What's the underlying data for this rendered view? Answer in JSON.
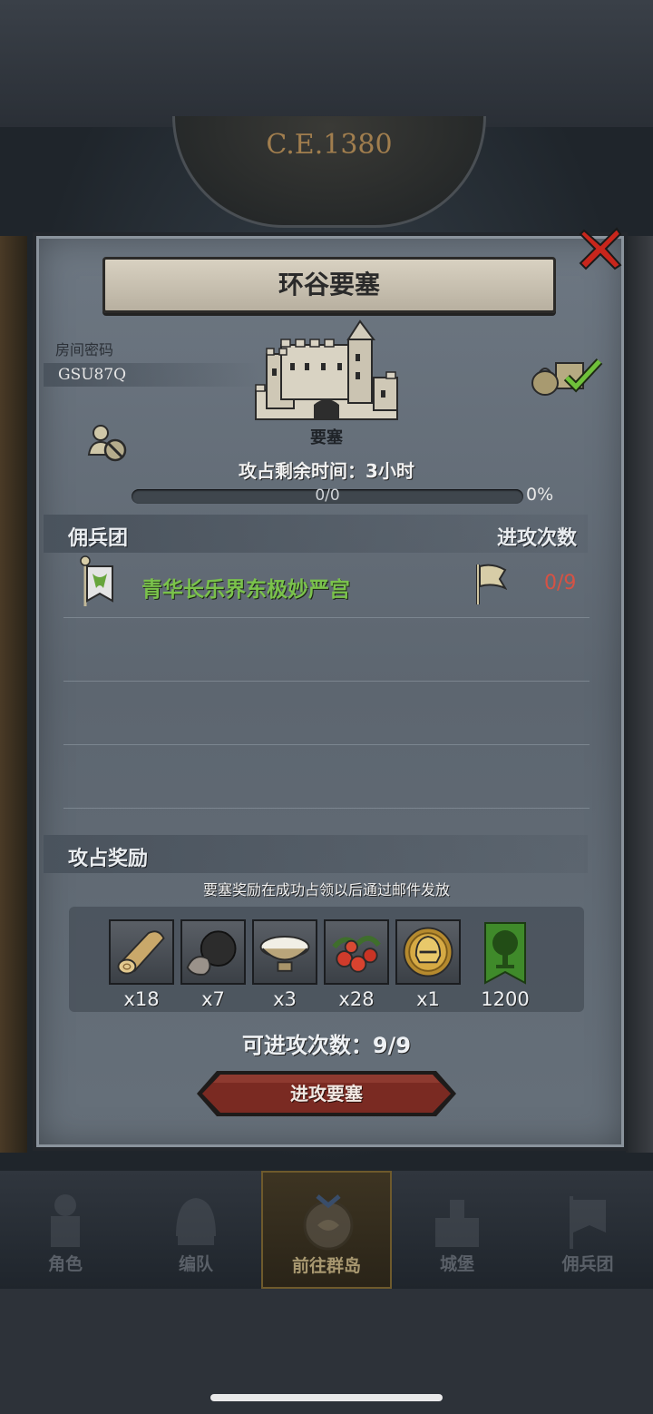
{
  "header": {
    "year": "C.E.1380"
  },
  "dialog": {
    "title": "环谷要塞",
    "room_label": "房间密码",
    "room_code": "GSU87Q",
    "fort_label": "要塞",
    "time_left": "攻占剩余时间：3小时",
    "progress": {
      "text": "0/0",
      "percent_label": "0%",
      "fraction": 0
    }
  },
  "mercenary": {
    "section_title": "佣兵团",
    "attack_header": "进攻次数",
    "rows": [
      {
        "name": "青华长乐界东极妙严宫",
        "count": "0/9"
      }
    ]
  },
  "rewards": {
    "section_title": "攻占奖励",
    "note": "要塞奖励在成功占领以后通过邮件发放",
    "items": [
      {
        "icon": "wood-log-icon",
        "qty": "x18"
      },
      {
        "icon": "truffle-icon",
        "qty": "x7"
      },
      {
        "icon": "milk-bowl-icon",
        "qty": "x3"
      },
      {
        "icon": "berries-icon",
        "qty": "x28"
      },
      {
        "icon": "gold-helmet-coin-icon",
        "qty": "x1"
      },
      {
        "icon": "guild-tree-banner-icon",
        "qty": "1200"
      }
    ]
  },
  "attacks_left": "可进攻次数：9/9",
  "attack_button": "进攻要塞",
  "nav": {
    "items": [
      {
        "label": "角色",
        "icon": "knight-icon"
      },
      {
        "label": "编队",
        "icon": "helmet-icon"
      },
      {
        "label": "前往群岛",
        "icon": "compass-map-icon"
      },
      {
        "label": "城堡",
        "icon": "castle-icon"
      },
      {
        "label": "佣兵团",
        "icon": "mercenary-banner-icon"
      }
    ],
    "active": "前往群岛"
  },
  "colors": {
    "guild_name": "#7ac24b",
    "attack_count": "#d65244",
    "close": "#c0281f",
    "button": "#7a2a22"
  }
}
